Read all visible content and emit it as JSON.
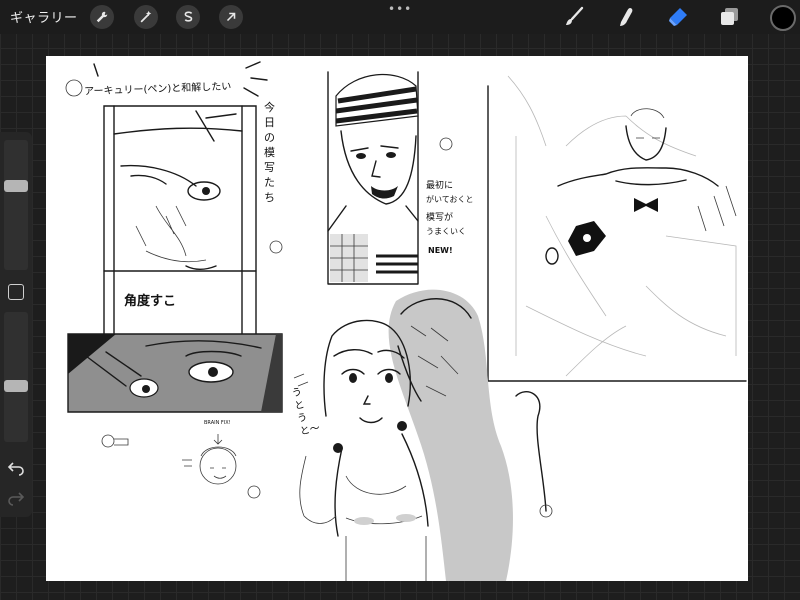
{
  "toolbar": {
    "gallery_label": "ギャラリー",
    "more_dots": "•••"
  },
  "icons": {
    "actions": "wrench-icon",
    "adjustments": "magic-wand-icon",
    "selection": "selection-s-icon",
    "transform": "arrow-cursor-icon",
    "brush": "brush-icon",
    "smudge": "smudge-finger-icon",
    "eraser": "eraser-icon",
    "layers": "layers-icon"
  },
  "colors": {
    "active_tool": "#2f7cf6",
    "current_color": "#000000"
  },
  "sidebar": {
    "brush_size": 0.66,
    "opacity": 0.42
  },
  "canvas_text": {
    "header_note": "アーキュリー(ペン)と和解したい",
    "vertical_note": "今日の模写たち",
    "bottom_note": "角度すこ",
    "side_note_1": "最初に",
    "side_note_2": "がいておくと",
    "side_note_3": "模写が",
    "side_note_4": "うまくいく",
    "side_note_5": "NEW!",
    "bubble_note": "うとうと〜",
    "small_note": "BRAIN FIX!"
  }
}
